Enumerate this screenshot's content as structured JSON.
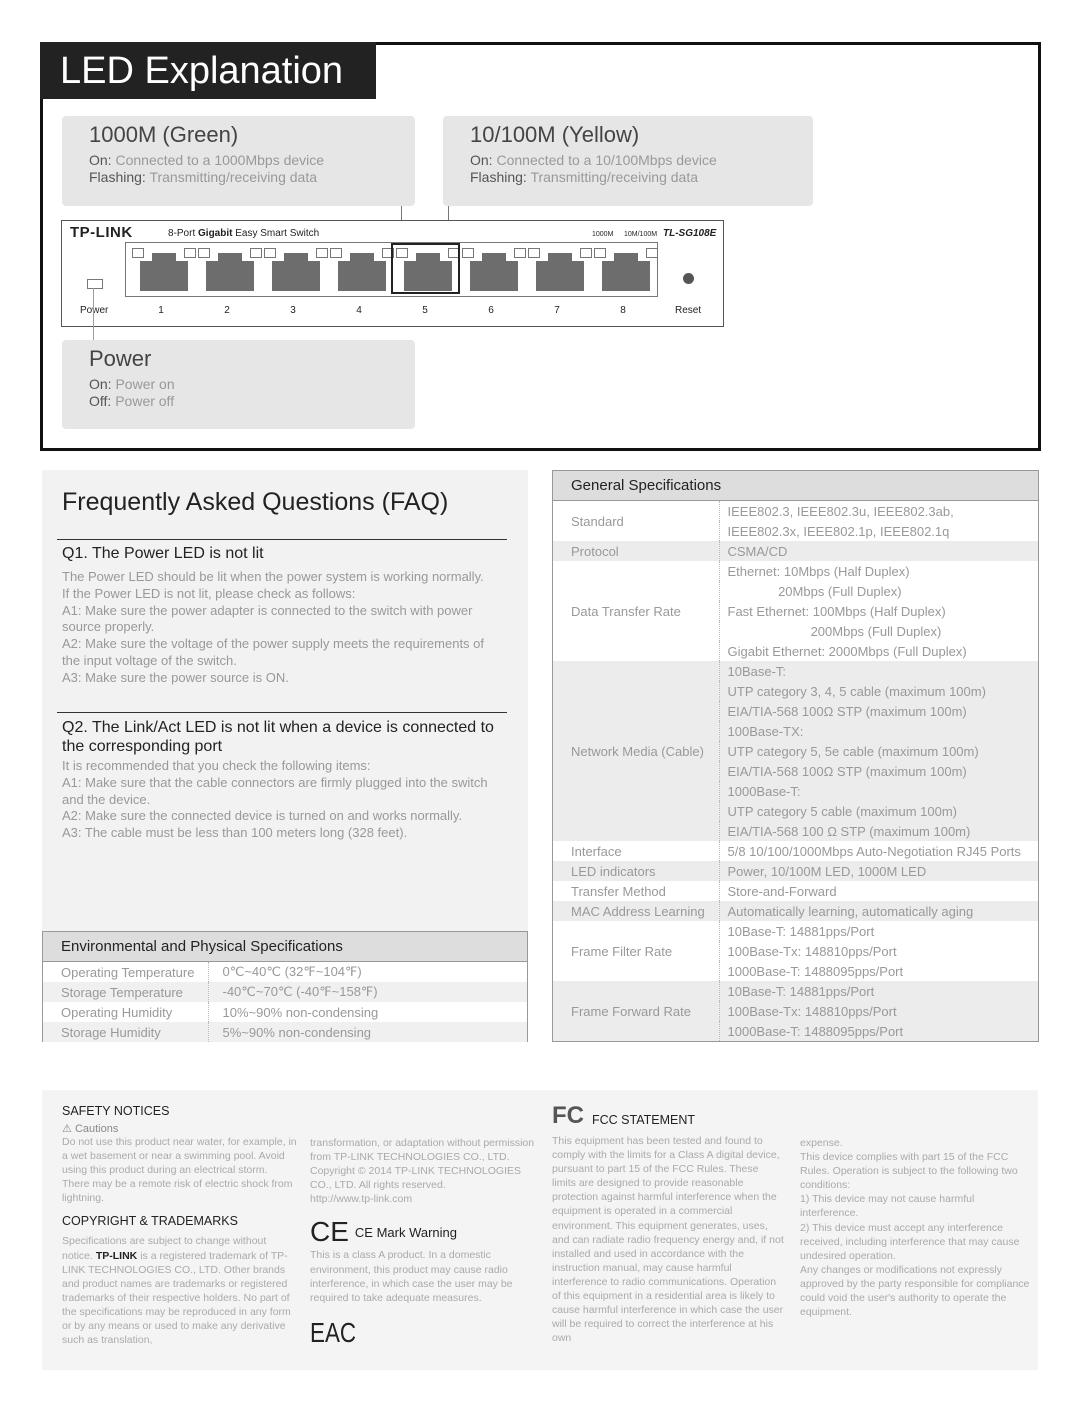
{
  "led": {
    "title": "LED Explanation",
    "green": {
      "title": "1000M (Green)",
      "on_label": "On:",
      "on_text": "Connected to a 1000Mbps device",
      "flash_label": "Flashing:",
      "flash_text": "Transmitting/receiving data"
    },
    "yellow": {
      "title": "10/100M (Yellow)",
      "on_label": "On:",
      "on_text": "Connected to a 10/100Mbps device",
      "flash_label": "Flashing:",
      "flash_text": "Transmitting/receiving data"
    },
    "power": {
      "title": "Power",
      "on_label": "On:",
      "on_text": "Power on",
      "off_label": "Off:",
      "off_text": "Power off"
    },
    "switch": {
      "brand": "TP-LINK",
      "desc_pre": "8-Port ",
      "desc_bold": "Gigabit",
      "desc_post": " Easy Smart Switch",
      "led1": "1000M",
      "led2": "10M/100M",
      "model": "TL-SG108E",
      "power": "Power",
      "reset": "Reset",
      "ports": [
        "1",
        "2",
        "3",
        "4",
        "5",
        "6",
        "7",
        "8"
      ]
    }
  },
  "faq": {
    "title": "Frequently Asked Questions (FAQ)",
    "q1": {
      "title": "Q1. The Power LED is not lit",
      "lines": [
        "The Power LED should be lit when the power system is working normally.",
        "If the Power LED is not lit, please check as follows:",
        "A1: Make sure the power adapter is connected to the switch with power source properly.",
        "A2: Make sure the voltage of the power supply meets the requirements of the input voltage of the switch.",
        "A3: Make sure the power source is ON."
      ]
    },
    "q2": {
      "title": "Q2. The Link/Act LED is not lit when a device is connected to the corresponding port",
      "lines": [
        "It is recommended that you check the following items:",
        "A1: Make sure that the cable connectors are firmly plugged into the switch and the device.",
        "A2: Make sure the connected device is turned on and works normally.",
        "A3: The cable must be less than 100 meters long (328 feet)."
      ]
    }
  },
  "env": {
    "title": "Environmental and Physical Specifications",
    "rows": [
      [
        "Operating Temperature",
        "0℃~40℃ (32℉~104℉)"
      ],
      [
        "Storage Temperature",
        "-40℃~70℃ (-40℉~158℉)"
      ],
      [
        "Operating Humidity",
        "10%~90% non-condensing"
      ],
      [
        "Storage Humidity",
        "5%~90% non-condensing"
      ]
    ]
  },
  "spec": {
    "title": "General Specifications",
    "rows": [
      {
        "label": "Standard",
        "values": [
          "IEEE802.3, IEEE802.3u, IEEE802.3ab,",
          "IEEE802.3x, IEEE802.1p, IEEE802.1q"
        ]
      },
      {
        "label": "Protocol",
        "values": [
          "CSMA/CD"
        ]
      },
      {
        "label": "Data Transfer Rate",
        "values": [
          "Ethernet: 10Mbps (Half Duplex)",
          "              20Mbps (Full Duplex)",
          "Fast Ethernet: 100Mbps (Half Duplex)",
          "                       200Mbps (Full Duplex)",
          "Gigabit Ethernet: 2000Mbps (Full Duplex)"
        ]
      },
      {
        "label": "Network Media (Cable)",
        "values": [
          "10Base-T:",
          "UTP category 3, 4, 5 cable (maximum 100m)",
          "EIA/TIA-568 100Ω STP (maximum 100m)",
          "100Base-TX:",
          "UTP category 5, 5e cable (maximum 100m)",
          "EIA/TIA-568 100Ω STP (maximum 100m)",
          "1000Base-T:",
          "UTP category 5 cable (maximum 100m)",
          "EIA/TIA-568 100 Ω STP (maximum 100m)"
        ]
      },
      {
        "label": "Interface",
        "values": [
          "5/8 10/100/1000Mbps Auto-Negotiation RJ45 Ports"
        ]
      },
      {
        "label": "LED indicators",
        "values": [
          "Power, 10/100M LED, 1000M LED"
        ]
      },
      {
        "label": "Transfer Method",
        "values": [
          "Store-and-Forward"
        ]
      },
      {
        "label": "MAC Address Learning",
        "values": [
          "Automatically learning, automatically aging"
        ]
      },
      {
        "label": "Frame Filter Rate",
        "values": [
          "10Base-T: 14881pps/Port",
          "100Base-Tx: 148810pps/Port",
          "1000Base-T: 1488095pps/Port"
        ]
      },
      {
        "label": "Frame Forward Rate",
        "values": [
          "10Base-T: 14881pps/Port",
          "100Base-Tx: 148810pps/Port",
          "1000Base-T: 1488095pps/Port"
        ]
      }
    ]
  },
  "notices": {
    "safety_title": "SAFETY NOTICES",
    "cautions": "Cautions",
    "safety_text": "Do not use this product near water, for example, in a wet basement or near a swimming pool. Avoid using this product during an electrical storm. There may be a remote risk of electric shock from lightning.",
    "copyright_title": "COPYRIGHT & TRADEMARKS",
    "copyright_pre": "Specifications are subject to change without notice.",
    "copyright_logo": "TP-LINK",
    "copyright_post": "is a registered trademark of TP-LINK TECHNOLOGIES CO., LTD. Other brands and product names are trademarks or registered trademarks of their respective holders. No part of the specifications may be reproduced in any form or by any means or used to make any derivative such as translation,",
    "copyright_cont": "transformation, or adaptation without permission from TP-LINK TECHNOLOGIES CO., LTD. Copyright © 2014 TP-LINK TECHNOLOGIES CO., LTD. All rights reserved.",
    "url": "http://www.tp-link.com",
    "ce_logo": "CE",
    "ce_title": "CE Mark Warning",
    "ce_text": "This is a class A product. In a domestic environment, this product may cause radio interference, in which case the user may be required to take adequate measures.",
    "eac_logo": "EAC",
    "fcc_logo": "FC",
    "fcc_title": "FCC STATEMENT",
    "fcc_text1": "This equipment has been tested and found to comply with the limits for a Class A digital device, pursuant to part 15 of the FCC Rules. These limits are designed to provide reasonable protection against harmful interference when the equipment is operated in a commercial environment. This equipment generates, uses, and can radiate radio frequency energy and, if not installed and used in accordance with the instruction manual, may cause harmful interference to radio communications. Operation of this equipment in a residential area is likely to cause harmful interference in which case the user will be required to correct the interference at his own",
    "fcc_text2": "expense.\nThis device complies with part 15 of the FCC Rules. Operation is subject to the following two conditions:\n1) This device may not cause harmful interference.\n2) This device must accept any interference received, including interference that may cause undesired operation.\nAny changes or modifications not expressly approved by the party responsible for compliance could void the user's authority to operate the equipment."
  }
}
